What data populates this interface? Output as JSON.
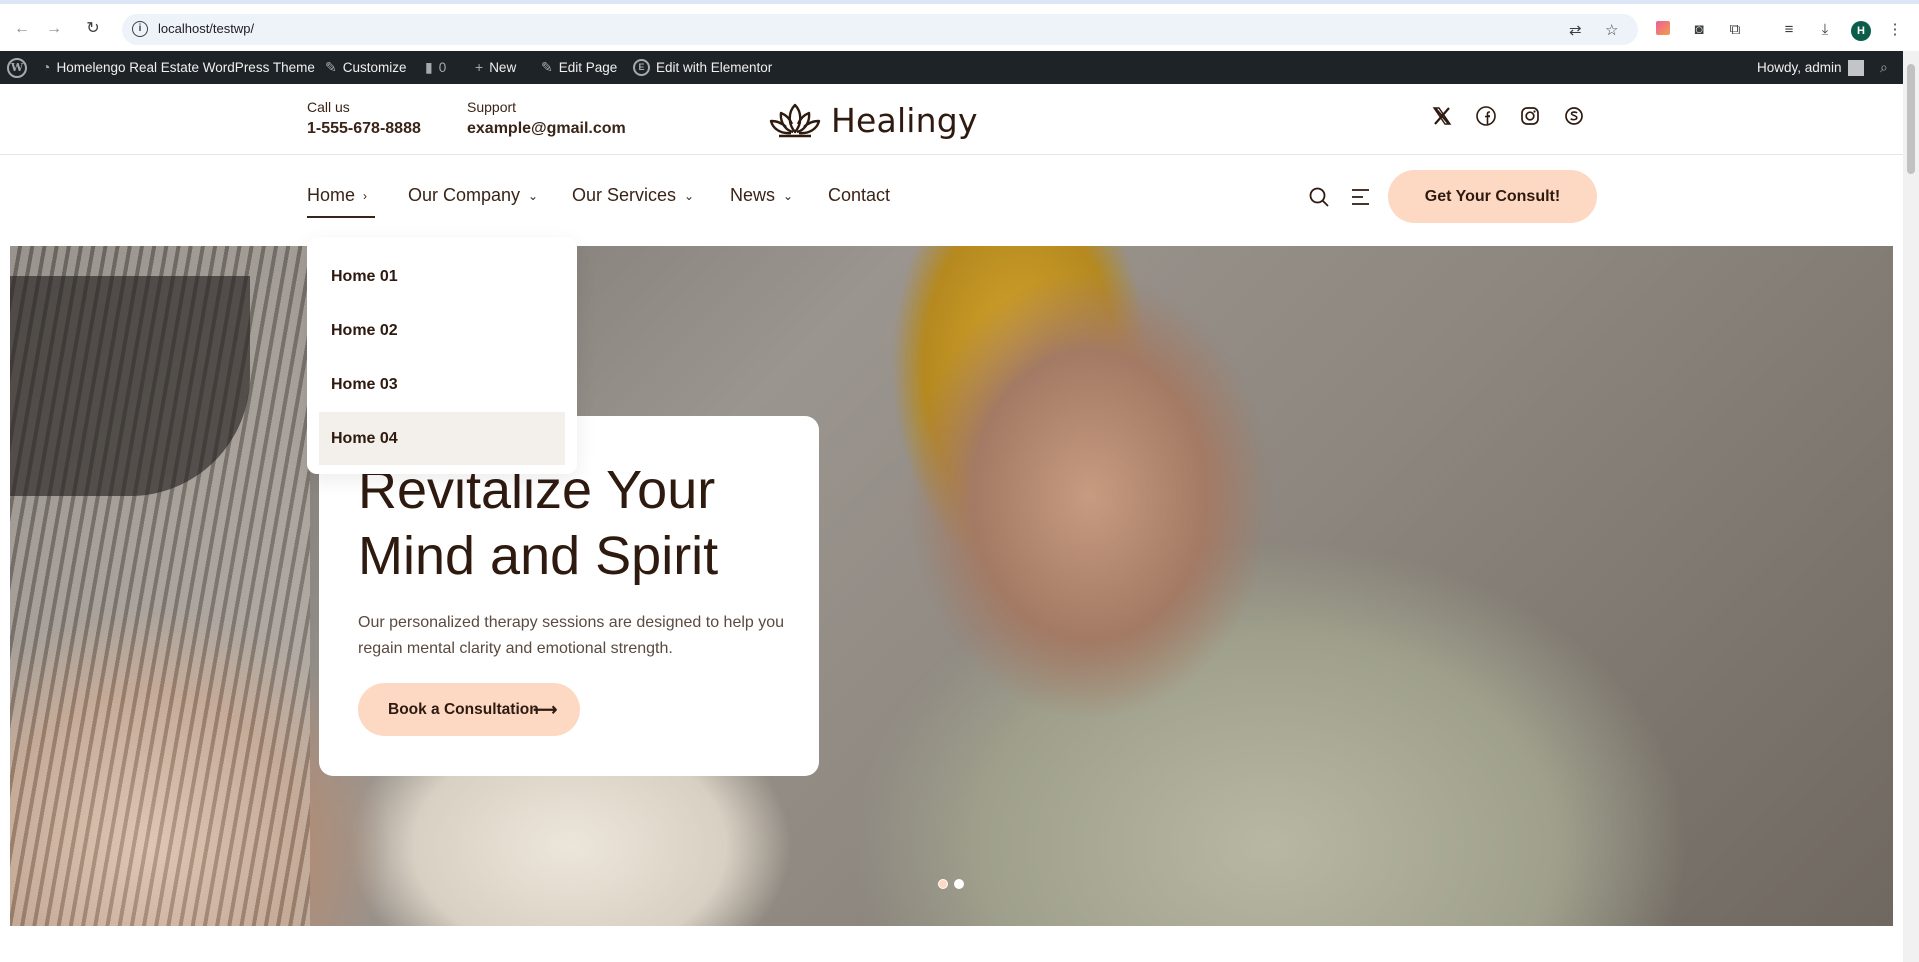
{
  "browser": {
    "url": "localhost/testwp/",
    "profile_initial": "H"
  },
  "admin_bar": {
    "site_name": "Homelengo Real Estate WordPress Theme",
    "customize": "Customize",
    "comments_count": "0",
    "new": "New",
    "edit_page": "Edit Page",
    "edit_elementor": "Edit with Elementor",
    "howdy": "Howdy, admin"
  },
  "header": {
    "call_label": "Call us",
    "call_value": "1-555-678-8888",
    "support_label": "Support",
    "support_value": "example@gmail.com",
    "logo_text": "Healingy",
    "social_icons": [
      "x-icon",
      "facebook-icon",
      "instagram-icon",
      "skype-icon"
    ]
  },
  "nav": {
    "items": [
      {
        "label": "Home",
        "chevron": "›"
      },
      {
        "label": "Our Company",
        "chevron": "⌄"
      },
      {
        "label": "Our Services",
        "chevron": "⌄"
      },
      {
        "label": "News",
        "chevron": "⌄"
      },
      {
        "label": "Contact",
        "chevron": ""
      }
    ],
    "cta": "Get Your Consult!"
  },
  "dropdown": {
    "items": [
      "Home 01",
      "Home 02",
      "Home 03",
      "Home 04"
    ],
    "hovered": "Home 04"
  },
  "hero": {
    "title_line1": "Revitalize Your",
    "title_line2": "Mind and Spirit",
    "description": "Our personalized therapy sessions are designed to help you regain mental clarity and emotional strength.",
    "button": "Book a Consultation",
    "slides": 2,
    "active_slide": 1
  },
  "colors": {
    "brand_dark": "#2f1a10",
    "accent_peach": "#fdd9c4",
    "admin_bar": "#1d2327"
  }
}
